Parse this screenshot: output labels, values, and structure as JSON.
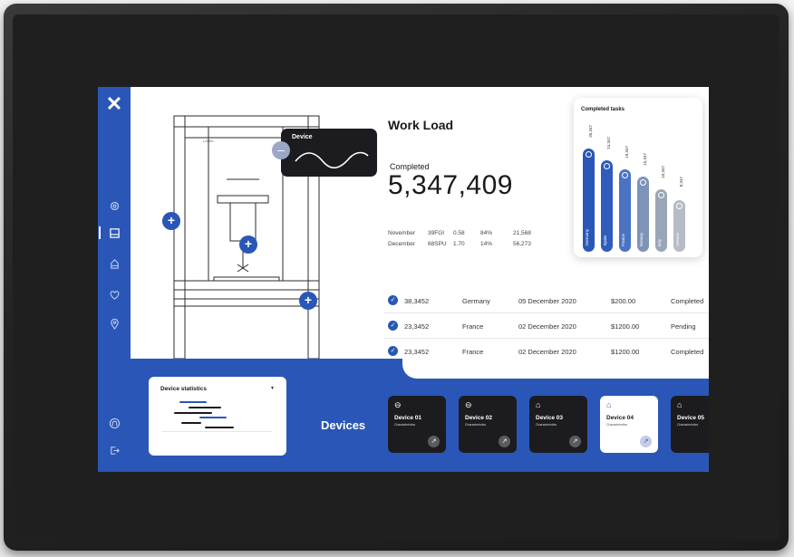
{
  "sidebar": {
    "logo": "✕",
    "icons": [
      "gear-icon",
      "layout-icon",
      "stack-icon",
      "heart-icon",
      "location-pin-icon",
      "support-icon",
      "logout-icon"
    ]
  },
  "machine": {
    "device_popup_label": "Device"
  },
  "workload": {
    "title": "Work Load",
    "completed_label": "Completed",
    "completed_value": "5,347,409",
    "rows": [
      {
        "month": "November",
        "code": "39FGI",
        "v1": "0.58",
        "pct": "84%",
        "total": "21,568"
      },
      {
        "month": "December",
        "code": "68SPU",
        "v1": "1.70",
        "pct": "14%",
        "total": "56,273"
      }
    ]
  },
  "completed_tasks": {
    "title": "Completed tasks",
    "bars": [
      {
        "label": "Germany",
        "value": "35,347",
        "color": "#2a57b7",
        "level": 0.88
      },
      {
        "label": "Spain",
        "value": "24,347",
        "color": "#2f5cbd",
        "level": 0.78
      },
      {
        "label": "France",
        "value": "19,347",
        "color": "#4a73c4",
        "level": 0.7
      },
      {
        "label": "Norway",
        "value": "15,347",
        "color": "#7f93b8",
        "level": 0.64
      },
      {
        "label": "Italy",
        "value": "10,347",
        "color": "#9aa6b8",
        "level": 0.53
      },
      {
        "label": "Greece",
        "value": "8,347",
        "color": "#b6bcc5",
        "level": 0.44
      }
    ]
  },
  "orders": [
    {
      "id": "38,3452",
      "country": "Germany",
      "date": "05 December 2020",
      "price": "$200.00",
      "status": "Completed"
    },
    {
      "id": "23,3452",
      "country": "France",
      "date": "02 December 2020",
      "price": "$1200.00",
      "status": "Pending"
    },
    {
      "id": "23,3452",
      "country": "France",
      "date": "02 December 2020",
      "price": "$1200.00",
      "status": "Completed"
    }
  ],
  "device_statistics": {
    "title": "Device statistics"
  },
  "devices": {
    "label": "Devices",
    "items": [
      {
        "name": "Device 01",
        "sub": "Characteristics",
        "selected": false
      },
      {
        "name": "Device 02",
        "sub": "Characteristics",
        "selected": false
      },
      {
        "name": "Device 03",
        "sub": "Characteristics",
        "selected": false
      },
      {
        "name": "Device 04",
        "sub": "Characteristics",
        "selected": true
      },
      {
        "name": "Device 05",
        "sub": "Characteristics",
        "selected": false
      }
    ]
  },
  "colors": {
    "accent": "#2a57b7",
    "dark_card": "#1c1c20",
    "bezel": "#232323"
  }
}
